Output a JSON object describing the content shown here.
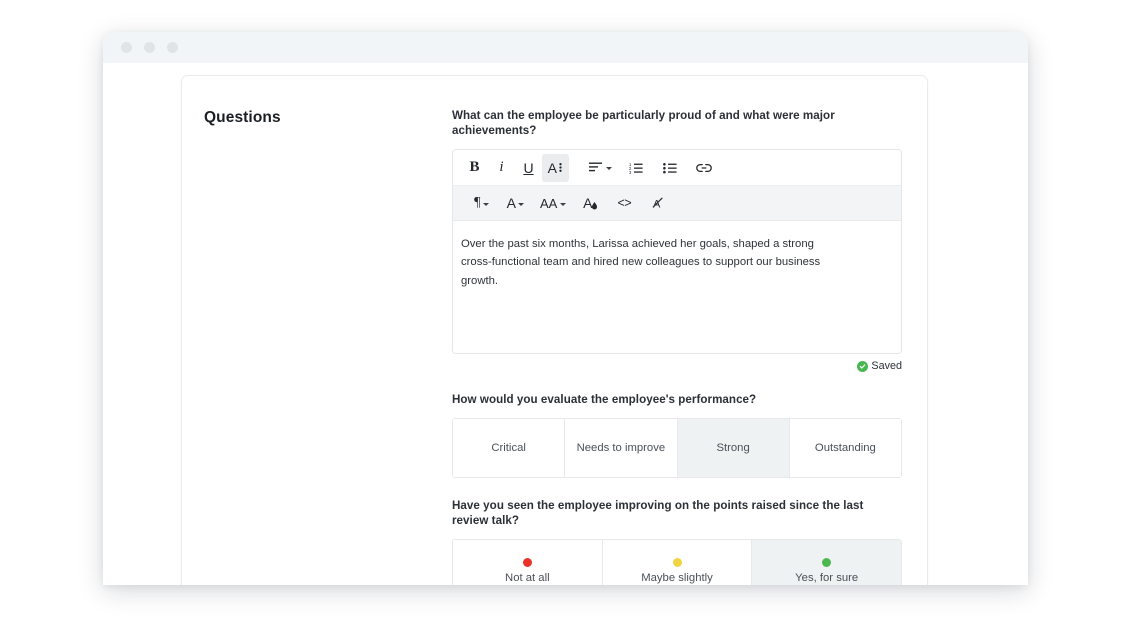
{
  "window": {
    "traffic_lights": [
      "close",
      "minimize",
      "maximize"
    ]
  },
  "card": {
    "section_title": "Questions"
  },
  "questions": [
    {
      "id": "achievements",
      "label": "What can the employee be particularly proud of and what were major achievements?",
      "type": "richtext",
      "value": "Over the past six months, Larissa achieved her goals, shaped a strong cross-functional team and hired new colleagues to support our business growth.",
      "status": "Saved",
      "status_color": "#48b750"
    },
    {
      "id": "performance",
      "label": "How would you evaluate the employee's performance?",
      "type": "rating",
      "options": [
        {
          "label": "Critical",
          "selected": false
        },
        {
          "label": "Needs to improve",
          "selected": false
        },
        {
          "label": "Strong",
          "selected": true
        },
        {
          "label": "Outstanding",
          "selected": false
        }
      ]
    },
    {
      "id": "improvement",
      "label": "Have you seen the employee improving on the points raised since the last review talk?",
      "type": "rating-dots",
      "options": [
        {
          "label": "Not at all",
          "dot_color": "#e8322a",
          "selected": false
        },
        {
          "label": "Maybe slightly",
          "dot_color": "#f0d442",
          "selected": false
        },
        {
          "label": "Yes, for sure",
          "dot_color": "#4cb850",
          "selected": true
        }
      ]
    }
  ],
  "editor_toolbar": {
    "row1": [
      {
        "name": "bold",
        "glyph": "B",
        "active": false
      },
      {
        "name": "italic",
        "glyph": "i",
        "active": false
      },
      {
        "name": "underline",
        "glyph": "U",
        "active": false
      },
      {
        "name": "text-style",
        "glyph": "A",
        "active": true
      },
      {
        "name": "align",
        "glyph": "",
        "active": false
      },
      {
        "name": "ordered-list",
        "glyph": "",
        "active": false
      },
      {
        "name": "bullet-list",
        "glyph": "",
        "active": false
      },
      {
        "name": "link",
        "glyph": "",
        "active": false
      }
    ],
    "row2": [
      {
        "name": "paragraph-style",
        "glyph": "¶",
        "active": false
      },
      {
        "name": "font-color",
        "glyph": "A",
        "active": false
      },
      {
        "name": "font-size",
        "glyph": "AA",
        "active": false
      },
      {
        "name": "highlight-color",
        "glyph": "A",
        "active": false
      },
      {
        "name": "code-block",
        "glyph": "<>",
        "active": false
      },
      {
        "name": "clear-formatting",
        "glyph": "A",
        "active": false
      }
    ]
  },
  "colors": {
    "titlebar": "#f2f5f7",
    "selected_cell": "#eef2f3",
    "toolbar_row2": "#f3f4f6",
    "border": "#e6e9eb"
  }
}
